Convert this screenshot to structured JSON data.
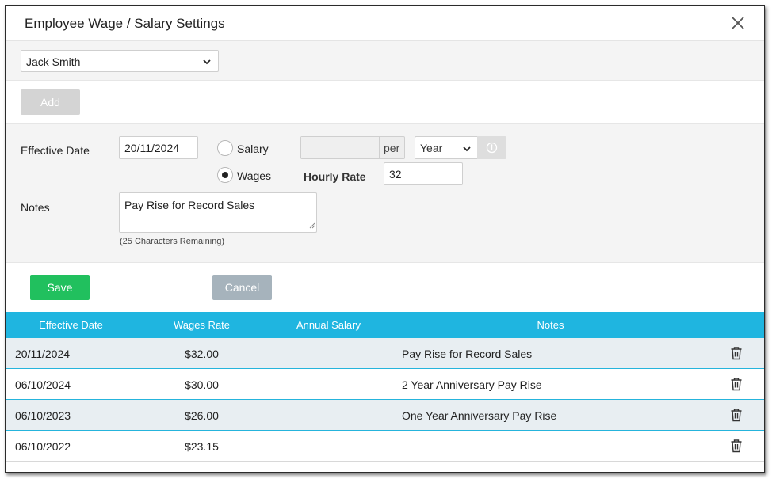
{
  "dialog": {
    "title": "Employee Wage / Salary Settings"
  },
  "employee_select": {
    "value": "Jack Smith"
  },
  "add_label": "Add",
  "form": {
    "effective_date_label": "Effective Date",
    "effective_date_value": "20/11/2024",
    "salary_label": "Salary",
    "wages_label": "Wages",
    "selected_type": "Wages",
    "salary_amount": "",
    "per_label": "per",
    "period_value": "Year",
    "hourly_rate_label": "Hourly Rate",
    "hourly_rate_value": "32",
    "notes_label": "Notes",
    "notes_value": "Pay Rise for Record Sales",
    "remaining_text": "(25 Characters Remaining)"
  },
  "buttons": {
    "save": "Save",
    "cancel": "Cancel"
  },
  "table": {
    "headers": [
      "Effective Date",
      "Wages Rate",
      "Annual Salary",
      "Notes"
    ],
    "rows": [
      {
        "date": "20/11/2024",
        "rate": "$32.00",
        "annual": "",
        "notes": "Pay Rise for Record Sales"
      },
      {
        "date": "06/10/2024",
        "rate": "$30.00",
        "annual": "",
        "notes": "2 Year Anniversary Pay Rise"
      },
      {
        "date": "06/10/2023",
        "rate": "$26.00",
        "annual": "",
        "notes": "One Year Anniversary Pay Rise"
      },
      {
        "date": "06/10/2022",
        "rate": "$23.15",
        "annual": "",
        "notes": ""
      }
    ]
  },
  "colors": {
    "header_blue": "#1fb5e0",
    "save_green": "#21c05e",
    "cancel_grey": "#a6b3bc",
    "add_disabled": "#d4d4d4"
  },
  "icons": [
    "close-icon",
    "chevron-down-icon",
    "info-icon",
    "trash-icon"
  ]
}
